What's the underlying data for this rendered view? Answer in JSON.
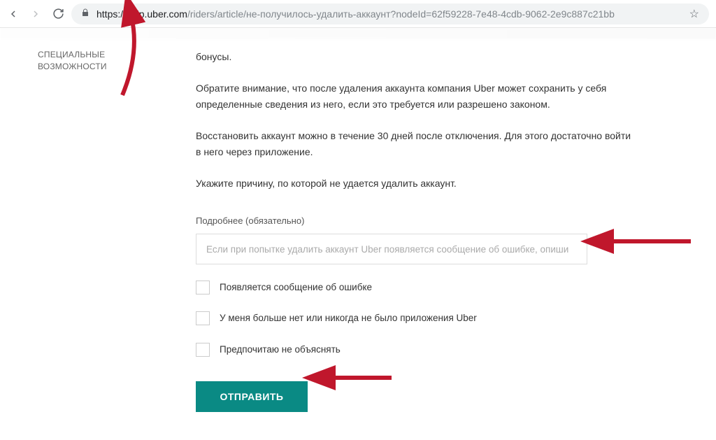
{
  "browser": {
    "url_host": "https://help.uber.com",
    "url_path": "/riders/article/не-получилось-удалить-аккаунт?nodeId=62f59228-7e48-4cdb-9062-2e9c887c21bb"
  },
  "sidebar": {
    "item0_line1": "СПЕЦИАЛЬНЫЕ",
    "item0_line2": "ВОЗМОЖНОСТИ"
  },
  "content": {
    "p0": "бонусы.",
    "p1": "Обратите внимание, что после удаления аккаунта компания Uber может сохранить у себя определенные сведения из него, если это требуется или разрешено законом.",
    "p2": "Восстановить аккаунт можно в течение 30 дней после отключения. Для этого достаточно войти в него через приложение.",
    "p3": "Укажите причину, по которой не удается удалить аккаунт."
  },
  "form": {
    "details_label": "Подробнее (обязательно)",
    "details_placeholder": "Если при попытке удалить аккаунт Uber появляется сообщение об ошибке, опиши",
    "checkbox1": "Появляется сообщение об ошибке",
    "checkbox2": "У меня больше нет или никогда не было приложения Uber",
    "checkbox3": "Предпочитаю не объяснять",
    "submit": "ОТПРАВИТЬ"
  }
}
